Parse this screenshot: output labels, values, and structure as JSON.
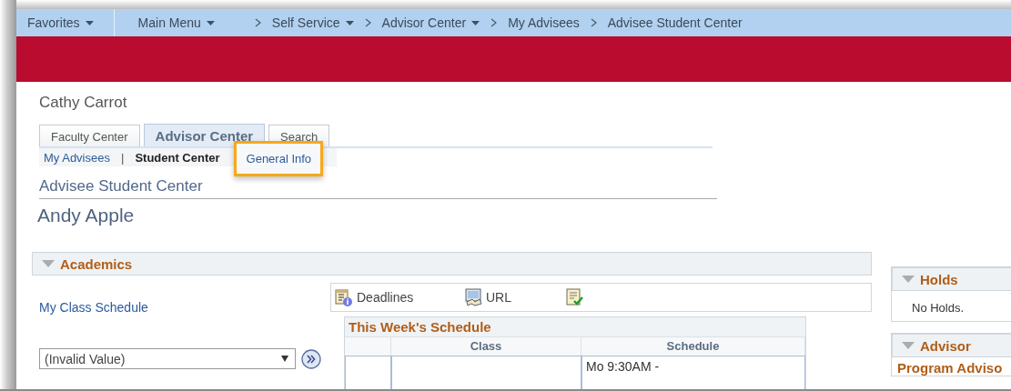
{
  "breadcrumb": [
    {
      "kind": "favorites",
      "label": "Favorites",
      "has_menu": true
    },
    {
      "kind": "menu",
      "label": "Main Menu",
      "has_menu": true
    },
    {
      "kind": "crumb",
      "label": "Self Service",
      "has_menu": true
    },
    {
      "kind": "crumb",
      "label": "Advisor Center",
      "has_menu": true
    },
    {
      "kind": "crumb",
      "label": "My Advisees",
      "has_menu": false
    },
    {
      "kind": "crumb",
      "label": "Advisee Student Center",
      "has_menu": false
    }
  ],
  "user_name": "Cathy Carrot",
  "tabs": [
    {
      "label": "Faculty Center",
      "selected": false
    },
    {
      "label": "Advisor Center",
      "selected": true
    },
    {
      "label": "Search",
      "selected": false
    }
  ],
  "sub_nav": [
    {
      "kind": "link",
      "label": "My Advisees",
      "selected": false,
      "highlighted": false
    },
    {
      "kind": "separator",
      "label": "|"
    },
    {
      "kind": "link",
      "label": "Student Center",
      "selected": true,
      "highlighted": false
    },
    {
      "kind": "link",
      "label": "General Info",
      "selected": false,
      "highlighted": true
    }
  ],
  "page_title": "Advisee Student Center",
  "student_name": "Andy Apple",
  "academics": {
    "title": "Academics",
    "expanded": true,
    "class_schedule_link": "My Class Schedule",
    "action_select": {
      "value": "(Invalid Value)"
    },
    "quick_links": [
      {
        "kind": "deadlines",
        "label": "Deadlines"
      },
      {
        "kind": "url",
        "label": "URL"
      },
      {
        "kind": "checklist"
      }
    ],
    "schedule": {
      "title": "This Week's Schedule",
      "columns": [
        "Class",
        "Schedule"
      ],
      "rows": [
        {
          "schedule": "Mo 9:30AM -"
        }
      ]
    }
  },
  "holds": {
    "title": "Holds",
    "expanded": true,
    "message": "No Holds."
  },
  "advisor": {
    "title": "Advisor",
    "expanded": true,
    "heading": "Program Adviso"
  }
}
